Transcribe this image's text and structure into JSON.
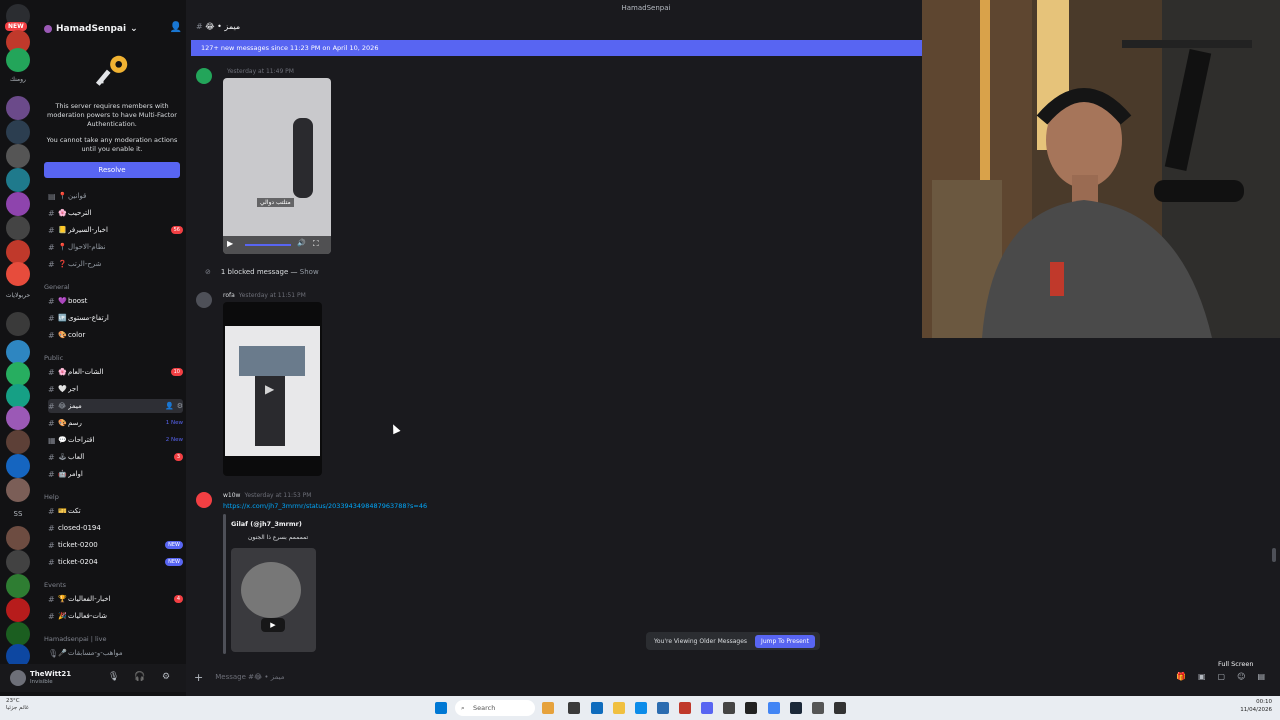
{
  "window": {
    "title": "HamadSenpai"
  },
  "rail": {
    "new_badge": "NEW",
    "labels": [
      "رومنك",
      "حربولايات",
      "SS"
    ]
  },
  "sidebar": {
    "server_name": "HamadSenpai",
    "mfa_notice": "This server requires members with moderation powers to have Multi-Factor Authentication.",
    "mfa_notice2": "You cannot take any moderation actions until you enable it.",
    "resolve_label": "Resolve",
    "channels_top": [
      {
        "name": "قوانين",
        "emoji": "📍"
      },
      {
        "name": "الترحيب",
        "emoji": "🌸"
      },
      {
        "name": "اخبار-السيرفر",
        "emoji": "📒",
        "badge": "56"
      },
      {
        "name": "نظام-الاحوال",
        "emoji": "📍"
      },
      {
        "name": "شرح-الرتب",
        "emoji": "❓"
      }
    ],
    "cat_general": "General",
    "channels_general": [
      {
        "name": "boost",
        "emoji": "💜"
      },
      {
        "name": "ارتفاع-مستوى",
        "emoji": "🆙"
      },
      {
        "name": "color",
        "emoji": "🎨"
      }
    ],
    "cat_public": "Public",
    "channels_public": [
      {
        "name": "الشات-العام",
        "emoji": "🌸",
        "badge": "10"
      },
      {
        "name": "اجر",
        "emoji": "🤍"
      },
      {
        "name": "ميمز",
        "emoji": "😂"
      },
      {
        "name": "رسم",
        "emoji": "🎨",
        "note": "1 New"
      },
      {
        "name": "اقتراحات",
        "emoji": "💬",
        "note": "2 New"
      },
      {
        "name": "ألعاب",
        "emoji": "🕹",
        "badge": "3"
      },
      {
        "name": "اوامر",
        "emoji": "🤖"
      }
    ],
    "cat_help": "Help",
    "channels_help": [
      {
        "name": "تكت",
        "emoji": "🎫"
      },
      {
        "name": "closed-0194",
        "emoji": ""
      },
      {
        "name": "ticket-0200",
        "emoji": "",
        "badge": "NEW"
      },
      {
        "name": "ticket-0204",
        "emoji": "",
        "badge": "NEW"
      }
    ],
    "cat_events": "Events",
    "channels_events": [
      {
        "name": "اخبار-الفعاليات",
        "emoji": "🏆",
        "badge": "4"
      },
      {
        "name": "شات-فعاليات",
        "emoji": "🎉"
      }
    ],
    "cat_live": "Hamadsenpai | live",
    "channels_live": [
      {
        "name": "مواهب-و-مسابقات",
        "emoji": "🎤"
      }
    ],
    "user": {
      "name": "TheWitt21",
      "status": "Invisible"
    }
  },
  "chat": {
    "channel_header": "ميمز",
    "new_messages_bar": "127+ new messages since 11:23 PM on April 10, 2026",
    "msg1": {
      "time": "Yesterday at 11:49 PM",
      "caption": "متلتب دوالي"
    },
    "blocked": {
      "text": "1 blocked message —",
      "show": "Show"
    },
    "msg2": {
      "author": "rofa",
      "time": "Yesterday at 11:51 PM"
    },
    "msg3": {
      "author": "w10w",
      "time": "Yesterday at 11:53 PM",
      "link": "https://x.com/jh7_3mrmr/status/2033943498487963788?s=46",
      "embed_author": "Gilaf (@jh7_3mrmr)",
      "embed_text": "تممممم بسرع ذا الجنون"
    },
    "older_text": "You're Viewing Older Messages",
    "jump_label": "Jump To Present",
    "input_placeholder": "Message #😂 • ميمز",
    "fullscreen_tip": "Full Screen"
  },
  "taskbar": {
    "weather_temp": "23°C",
    "weather_desc": "غائم جزئيا",
    "search": "Search",
    "time": "00:10",
    "date": "11/04/2026"
  }
}
